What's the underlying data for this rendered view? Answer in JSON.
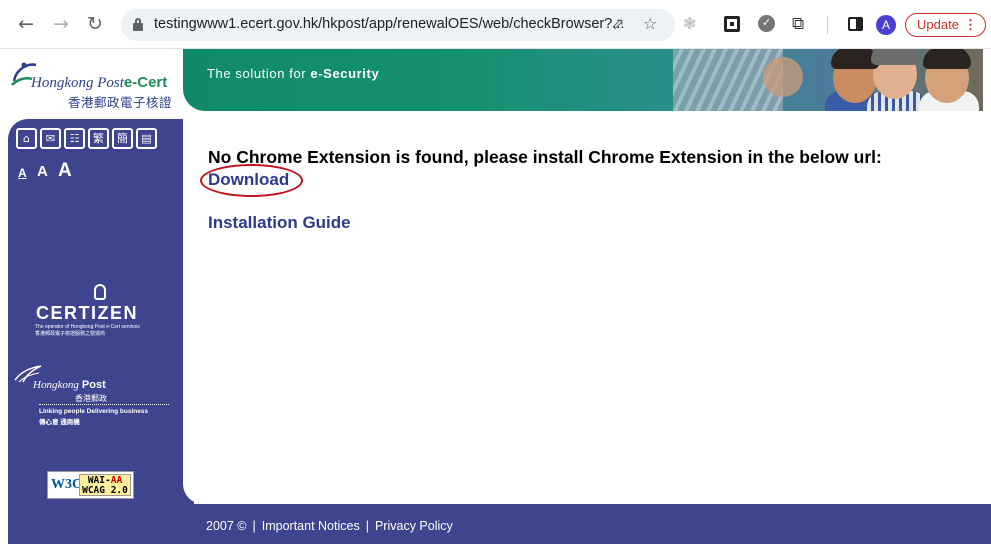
{
  "browser": {
    "url": "testingwww1.ecert.gov.hk/hkpost/app/renewalOES/web/checkBrowser?...",
    "avatar_letter": "A",
    "update_label": "Update"
  },
  "header": {
    "logo_en": "Hongkong Post",
    "logo_brand": "e-Cert",
    "logo_zh": "香港郵政電子核證",
    "tagline_prefix": "The solution for ",
    "tagline_bold": "e-Security"
  },
  "sidebar": {
    "util_icons": [
      "home-icon",
      "mail-icon",
      "sitemap-icon",
      "traditional-chinese",
      "simplified-chinese",
      "text-only-icon"
    ],
    "util_glyphs": [
      "⌂",
      "✉",
      "☷",
      "繁",
      "簡",
      "▤"
    ],
    "font_sizes": [
      "A",
      "A",
      "A"
    ],
    "certizen_word": "CERTIZEN",
    "certizen_sub1": "The operator of Hongkong Post e-Cert services",
    "certizen_sub2": "香港郵政電子核證服務之營運商",
    "hkpost_word": "Hongkong",
    "hkpost_word2": "Post",
    "hkpost_zh": "香港郵政",
    "hkpost_tag1": "Linking people Delivering business",
    "hkpost_tag2": "傳心意 通商機",
    "w3c": "W3C",
    "wai_line1": "WAI-",
    "wai_aa": "AA",
    "wai_line2": "WCAG 2.0"
  },
  "main": {
    "headline": "No Chrome Extension is found, please install Chrome Extension in the below url:",
    "download_label": "Download",
    "guide_label": "Installation Guide"
  },
  "footer": {
    "copyright": "2007 ©",
    "notices": "Important Notices",
    "privacy": "Privacy Policy",
    "divider": "|"
  },
  "colors": {
    "sidebar": "#3f448f",
    "link": "#2e3a8c",
    "highlight_circle": "#c0121b"
  }
}
